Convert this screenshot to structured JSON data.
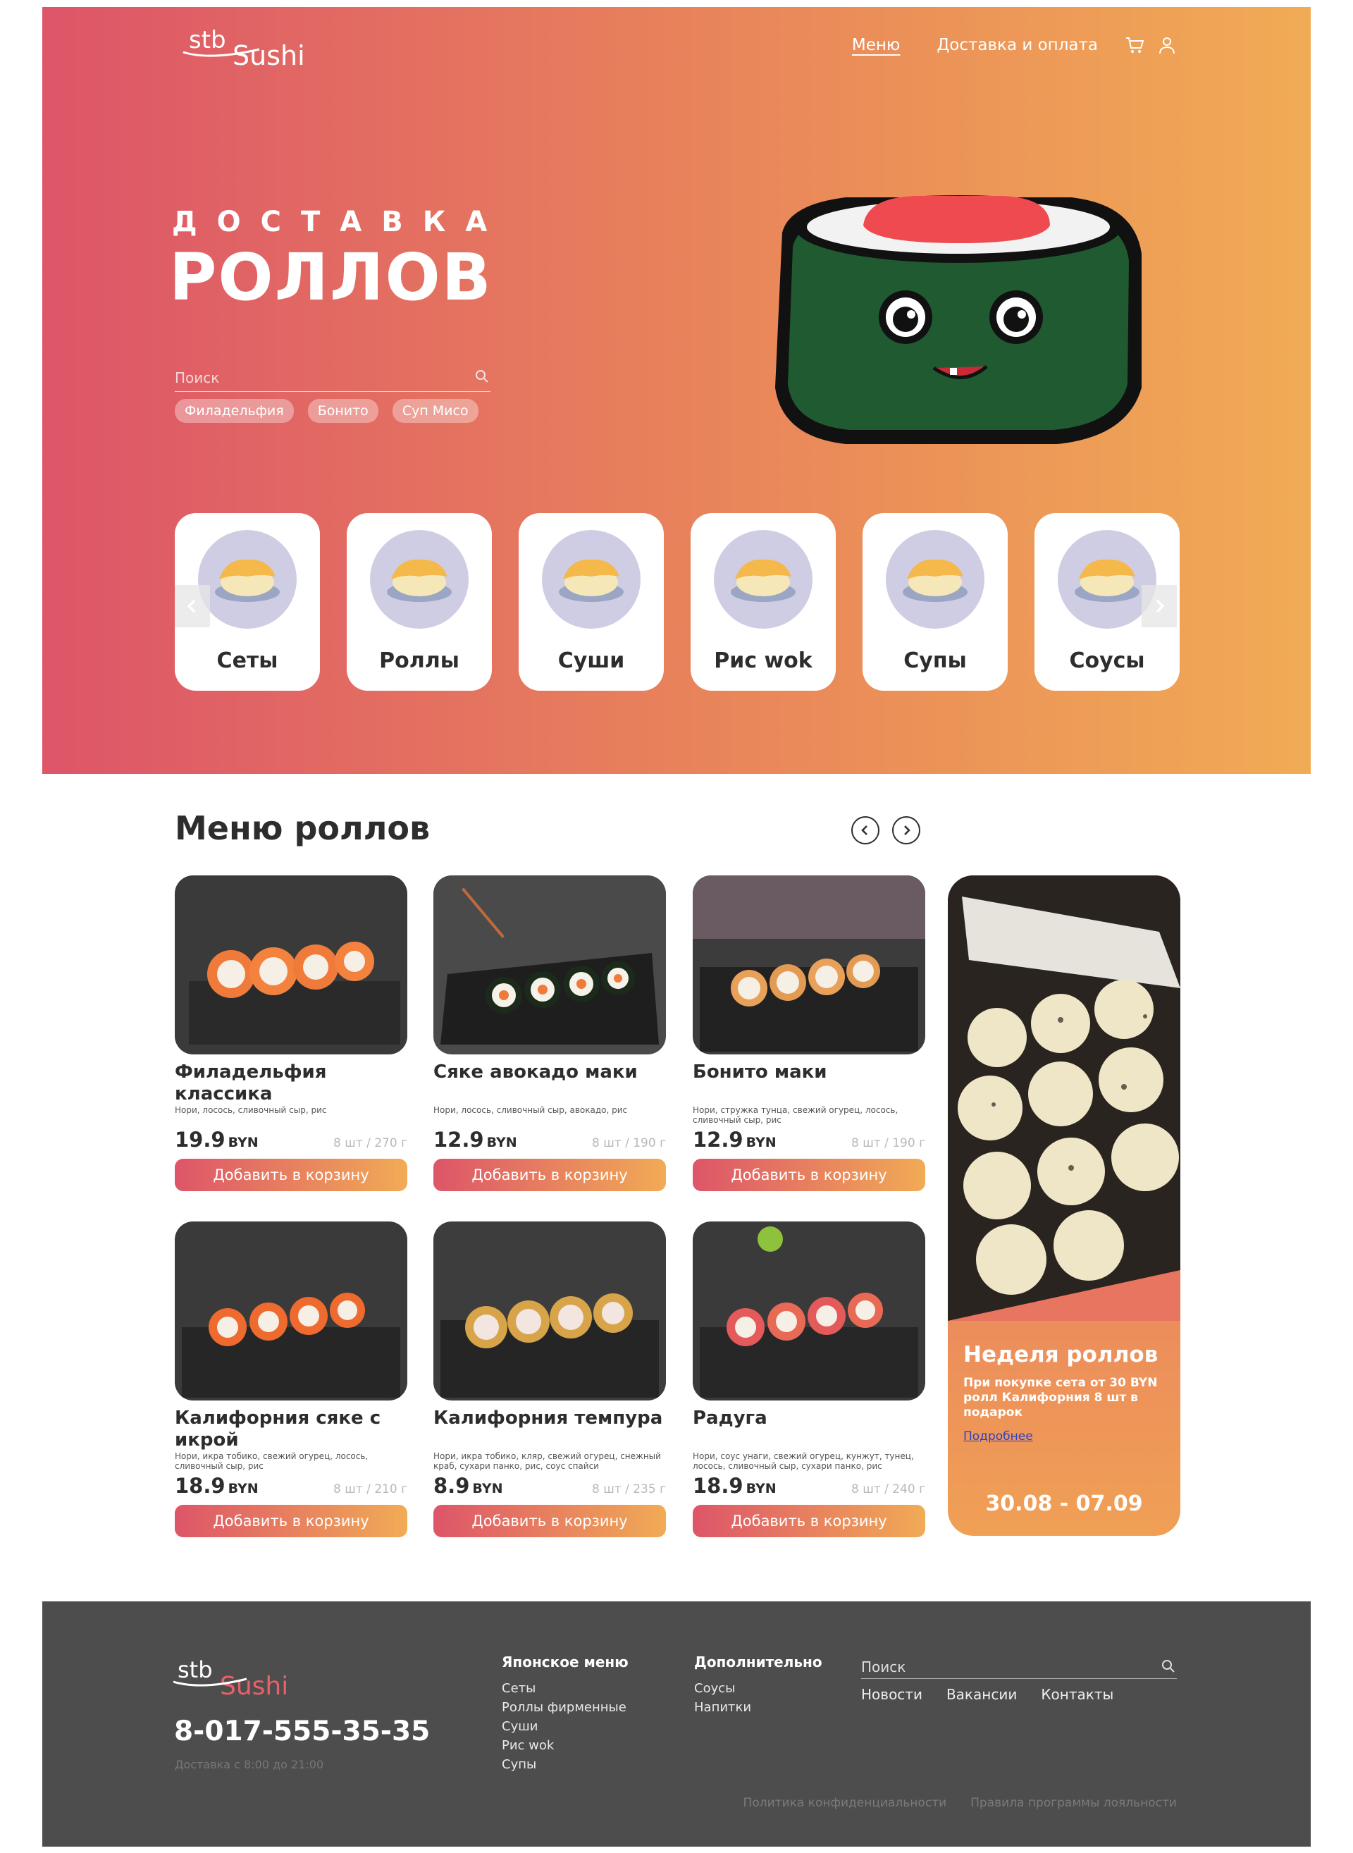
{
  "header": {
    "logo_prefix": "stb",
    "logo_main": "Sushi",
    "nav": [
      {
        "label": "Меню"
      },
      {
        "label": "Доставка и оплата"
      }
    ],
    "icons": [
      "cart-icon",
      "user-icon"
    ]
  },
  "hero": {
    "subtitle": "ДОСТАВКА",
    "title": "РОЛЛОВ",
    "search_placeholder": "Поиск",
    "chips": [
      "Филадельфия",
      "Бонито",
      "Суп Мисо"
    ]
  },
  "categories": [
    {
      "label": "Сеты"
    },
    {
      "label": "Роллы"
    },
    {
      "label": "Суши"
    },
    {
      "label": "Рис wok"
    },
    {
      "label": "Супы"
    },
    {
      "label": "Соусы"
    }
  ],
  "menu": {
    "title": "Меню роллов",
    "products": [
      {
        "name": "Филадельфия классика",
        "desc": "Нори, лосось, сливочный сыр, рис",
        "price": "19.9",
        "currency": "BYN",
        "weight": "8 шт / 270 г",
        "button": "Добавить в корзину"
      },
      {
        "name": "Сяке авокадо маки",
        "desc": "Нори, лосось, сливочный сыр, авокадо, рис",
        "price": "12.9",
        "currency": "BYN",
        "weight": "8 шт / 190 г",
        "button": "Добавить в корзину"
      },
      {
        "name": "Бонито маки",
        "desc": "Нори, стружка тунца, свежий огурец, лосось, сливочный сыр, рис",
        "price": "12.9",
        "currency": "BYN",
        "weight": "8 шт / 190 г",
        "button": "Добавить в корзину"
      },
      {
        "name": "Калифорния сяке с икрой",
        "desc": "Нори, икра тобико, свежий огурец, лосось, сливочный сыр, рис",
        "price": "18.9",
        "currency": "BYN",
        "weight": "8 шт / 210 г",
        "button": "Добавить в корзину"
      },
      {
        "name": "Калифорния темпура",
        "desc": "Нори, икра тобико, кляр, свежий огурец, снежный краб, сухари панко, рис, соус спайси",
        "price": "8.9",
        "currency": "BYN",
        "weight": "8 шт / 235 г",
        "button": "Добавить в корзину"
      },
      {
        "name": "Радуга",
        "desc": "Нори, соус унаги, свежий огурец, кунжут, тунец, лосось, сливочный сыр, сухари панко, рис",
        "price": "18.9",
        "currency": "BYN",
        "weight": "8 шт / 240 г",
        "button": "Добавить в корзину"
      }
    ],
    "promo": {
      "title": "Неделя роллов",
      "text": "При покупке сета от 30 BYN ролл Калифорния 8 шт в подарок",
      "link": "Подробнее",
      "dates": "30.08 - 07.09"
    }
  },
  "footer": {
    "phone": "8-017-555-35-35",
    "hours": "Доставка с 8:00 до 21:00",
    "col1": {
      "title": "Японское меню",
      "items": [
        "Сеты",
        "Роллы фирменные",
        "Суши",
        "Рис wok",
        "Супы"
      ]
    },
    "col2": {
      "title": "Дополнительно",
      "items": [
        "Соусы",
        "Напитки"
      ]
    },
    "search_placeholder": "Поиск",
    "links": [
      "Новости",
      "Вакансии",
      "Контакты"
    ],
    "legal": [
      "Политика конфиденциальности",
      "Правила программы лояльности"
    ]
  },
  "colors": {
    "gradient_start": "#dd5569",
    "gradient_end": "#f1ab55",
    "footer_bg": "#4d4d4d"
  }
}
